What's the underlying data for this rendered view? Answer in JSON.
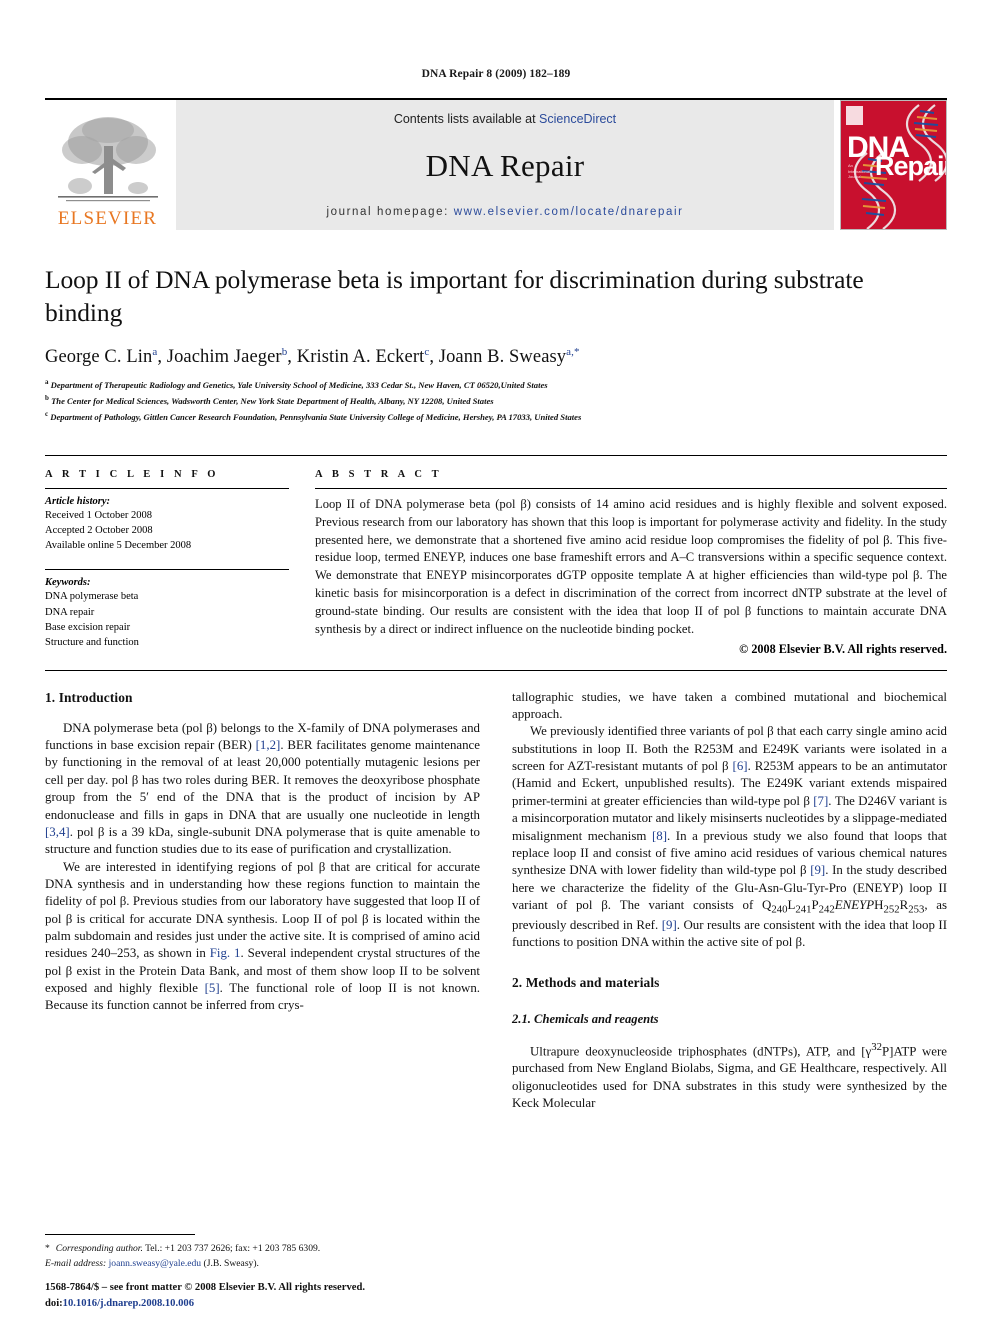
{
  "running_head": "DNA Repair 8 (2009) 182–189",
  "masthead": {
    "publisher_name": "ELSEVIER",
    "contents_prefix": "Contents lists available at ",
    "sciencedirect": "ScienceDirect",
    "journal_title": "DNA Repair",
    "homepage_prefix": "journal homepage: ",
    "homepage_url": "www.elsevier.com/locate/dnarepair",
    "cover": {
      "line1": "DNA",
      "line2": "Repair",
      "subtitle": "An International Journal"
    },
    "accent_red": "#c8102e",
    "accent_orange": "#e87722",
    "link_blue": "#2b4b9b"
  },
  "article": {
    "title": "Loop II of DNA polymerase beta is important for discrimination during substrate binding",
    "authors": [
      {
        "name": "George C. Lin",
        "sup": "a"
      },
      {
        "name": "Joachim Jaeger",
        "sup": "b"
      },
      {
        "name": "Kristin A. Eckert",
        "sup": "c"
      },
      {
        "name": "Joann B. Sweasy",
        "sup": "a,*"
      }
    ],
    "affiliations": [
      {
        "mark": "a",
        "text": "Department of Therapeutic Radiology and Genetics, Yale University School of Medicine, 333 Cedar St., New Haven, CT 06520,United States"
      },
      {
        "mark": "b",
        "text": "The Center for Medical Sciences, Wadsworth Center, New York State Department of Health, Albany, NY 12208, United States"
      },
      {
        "mark": "c",
        "text": "Department of Pathology, Gittlen Cancer Research Foundation, Pennsylvania State University College of Medicine, Hershey, PA 17033, United States"
      }
    ]
  },
  "article_info": {
    "heading": "A R T I C L E    I N F O",
    "history_label": "Article history:",
    "history": [
      "Received 1 October 2008",
      "Accepted 2 October 2008",
      "Available online 5 December 2008"
    ],
    "keywords_label": "Keywords:",
    "keywords": [
      "DNA polymerase beta",
      "DNA repair",
      "Base excision repair",
      "Structure and function"
    ]
  },
  "abstract": {
    "heading": "A B S T R A C T",
    "text": "Loop II of DNA polymerase beta (pol β) consists of 14 amino acid residues and is highly flexible and solvent exposed. Previous research from our laboratory has shown that this loop is important for polymerase activity and fidelity. In the study presented here, we demonstrate that a shortened five amino acid residue loop compromises the fidelity of pol β. This five-residue loop, termed ENEYP, induces one base frameshift errors and A–C transversions within a specific sequence context. We demonstrate that ENEYP misincorporates dGTP opposite template A at higher efficiencies than wild-type pol β. The kinetic basis for misincorporation is a defect in discrimination of the correct from incorrect dNTP substrate at the level of ground-state binding. Our results are consistent with the idea that loop II of pol β functions to maintain accurate DNA synthesis by a direct or indirect influence on the nucleotide binding pocket.",
    "copyright": "© 2008 Elsevier B.V. All rights reserved."
  },
  "body": {
    "section1_heading": "1.  Introduction",
    "intro_p1_a": "DNA polymerase beta (pol β) belongs to the X-family of DNA polymerases and functions in base excision repair (BER) ",
    "intro_p1_ref1": "[1,2]",
    "intro_p1_b": ". BER facilitates genome maintenance by functioning in the removal of at least 20,000 potentially mutagenic lesions per cell per day. pol β has two roles during BER. It removes the deoxyribose phosphate group from the 5′ end of the DNA that is the product of incision by AP endonuclease and fills in gaps in DNA that are usually one nucleotide in length ",
    "intro_p1_ref2": "[3,4]",
    "intro_p1_c": ". pol β is a 39 kDa, single-subunit DNA polymerase that is quite amenable to structure and function studies due to its ease of purification and crystallization.",
    "intro_p2_a": "We are interested in identifying regions of pol β that are critical for accurate DNA synthesis and in understanding how these regions function to maintain the fidelity of pol β. Previous studies from our laboratory have suggested that loop II of pol β is critical for accurate DNA synthesis. Loop II of pol β is located within the palm subdomain and resides just under the active site. It is comprised of amino acid residues 240–253, as shown in ",
    "intro_p2_fig": "Fig. 1",
    "intro_p2_b": ". Several independent crystal structures of the pol β exist in the Protein Data Bank, and most of them show loop II to be solvent exposed and highly flexible ",
    "intro_p2_ref": "[5]",
    "intro_p2_c": ". The functional role of loop II is not known. Because its function cannot be inferred from crys-",
    "intro_p2_cont": "tallographic studies, we have taken a combined mutational and biochemical approach.",
    "intro_p3_a": "We previously identified three variants of pol β that each carry single amino acid substitutions in loop II. Both the R253M and E249K variants were isolated in a screen for AZT-resistant mutants of pol β ",
    "intro_p3_ref6": "[6]",
    "intro_p3_b": ". R253M appears to be an antimutator (Hamid and Eckert, unpublished results). The E249K variant extends mispaired primer-termini at greater efficiencies than wild-type pol β ",
    "intro_p3_ref7": "[7]",
    "intro_p3_c": ". The D246V variant is a misincorporation mutator and likely misinserts nucleotides by a slippage-mediated misalignment mechanism ",
    "intro_p3_ref8": "[8]",
    "intro_p3_d": ". In a previous study we also found that loops that replace loop II and consist of five amino acid residues of various chemical natures synthesize DNA with lower fidelity than wild-type pol β ",
    "intro_p3_ref9": "[9]",
    "intro_p3_e": ". In the study described here we characterize the fidelity of the Glu-Asn-Glu-Tyr-Pro (ENEYP) loop II variant of pol β. The variant consists of Q",
    "intro_p3_f": ", as previously described in Ref. ",
    "intro_p3_ref9b": "[9]",
    "intro_p3_g": ". Our results are consistent with the idea that loop II functions to position DNA within the active site of pol β.",
    "section2_heading": "2.  Methods and materials",
    "subsection21_heading": "2.1.  Chemicals and reagents",
    "methods_p1_a": "Ultrapure deoxynucleoside triphosphates (dNTPs), ATP, and [γ",
    "methods_p1_sup": "32",
    "methods_p1_b": "P]ATP were purchased from New England Biolabs, Sigma, and GE Healthcare, respectively. All oligonucleotides used for DNA substrates in this study were synthesized by the Keck Molecular"
  },
  "footnote": {
    "star": "*",
    "corresponding_label": "Corresponding author.",
    "tel": " Tel.: +1 203 737 2626; fax: +1 203 785 6309.",
    "email_label": "E-mail address:",
    "email": "joann.sweasy@yale.edu",
    "email_owner": "(J.B. Sweasy)."
  },
  "footer": {
    "issn_line": "1568-7864/$ – see front matter © 2008 Elsevier B.V. All rights reserved.",
    "doi_label": "doi:",
    "doi": "10.1016/j.dnarep.2008.10.006"
  }
}
